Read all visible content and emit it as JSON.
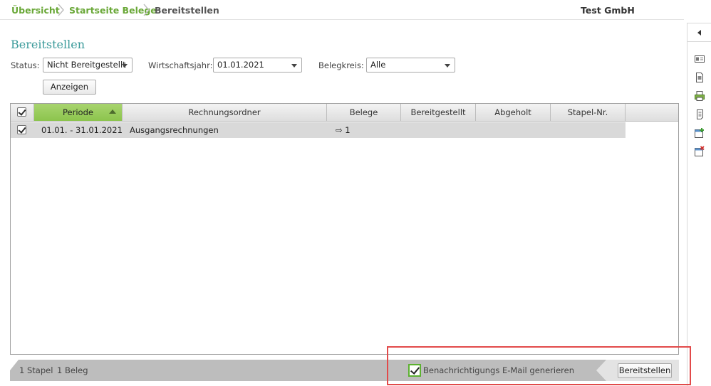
{
  "breadcrumb": {
    "items": [
      "Übersicht",
      "Startseite Belege",
      "Bereitstellen"
    ],
    "company": "Test GmbH"
  },
  "page": {
    "title": "Bereitstellen"
  },
  "filters": {
    "status_label": "Status:",
    "status_value": "Nicht Bereitgestellt",
    "fiscal_year_label": "Wirtschaftsjahr:",
    "fiscal_year_value": "01.01.2021",
    "belegkreis_label": "Belegkreis:",
    "belegkreis_value": "Alle",
    "show_button": "Anzeigen"
  },
  "grid": {
    "columns": [
      "Periode",
      "Rechnungsordner",
      "Belege",
      "Bereitgestellt",
      "Abgeholt",
      "Stapel-Nr."
    ],
    "sorted_column": "Periode",
    "rows": [
      {
        "checked": true,
        "periode": "01.01. - 31.01.2021",
        "rechnungsordner": "Ausgangsrechnungen",
        "belege": "⇨ 1",
        "bereitgestellt": "",
        "abgeholt": "",
        "stapel_nr": ""
      }
    ]
  },
  "footer": {
    "stapel_count": "1",
    "stapel_label": "Stapel",
    "beleg_count": "1",
    "beleg_label": "Beleg",
    "notify_label": "Benachrichtigungs E-Mail generieren",
    "notify_checked": true,
    "submit_button": "Bereitstellen"
  },
  "colors": {
    "accent_green": "#6aa838",
    "title_teal": "#3a9a9a",
    "highlight_red": "#e24a4a"
  },
  "rail": {
    "icons": [
      "collapse-icon",
      "contact-card-icon",
      "document-icon",
      "print-icon",
      "notes-icon",
      "calendar-add-icon",
      "calendar-delete-icon"
    ]
  }
}
